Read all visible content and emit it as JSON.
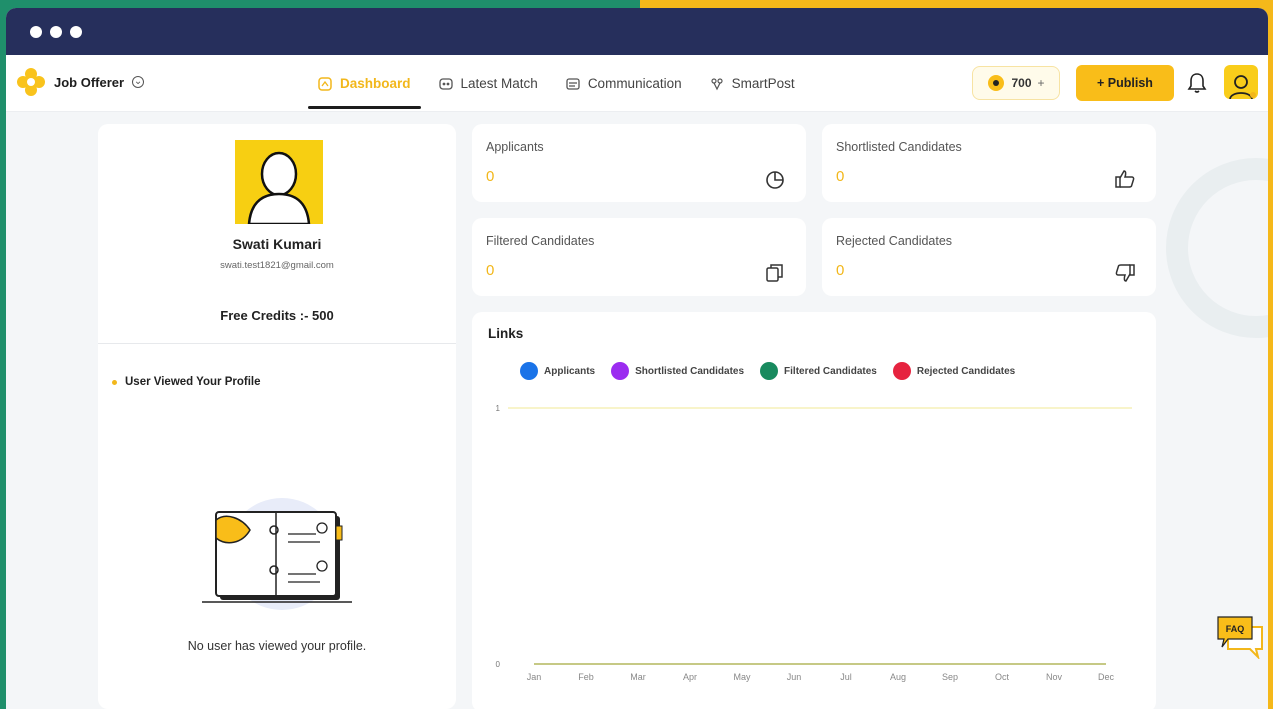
{
  "window_controls": [
    "close",
    "minimize",
    "maximize"
  ],
  "brand": {
    "name": "Job Offerer",
    "logo_icon": "flower-logo-icon",
    "chevron_icon": "chevron-down-circle-icon"
  },
  "tabs": [
    {
      "label": "Dashboard",
      "icon": "dashboard-icon",
      "active": true
    },
    {
      "label": "Latest Match",
      "icon": "match-icon",
      "active": false
    },
    {
      "label": "Communication",
      "icon": "chat-icon",
      "active": false
    },
    {
      "label": "SmartPost",
      "icon": "smartpost-icon",
      "active": false
    }
  ],
  "header": {
    "credits_value": "700",
    "credits_plus": "+",
    "publish_label": "+ Publish"
  },
  "colors": {
    "accent": "#f9bd19",
    "titlebar": "#262f5c",
    "applicants": "#1a73e8",
    "shortlisted": "#9b2cf0",
    "filtered": "#188a5e",
    "rejected": "#e6233f"
  },
  "profile": {
    "name": "Swati Kumari",
    "email": "swati.test1821@gmail.com",
    "credits_text": "Free Credits :- 500",
    "viewed_title": "User Viewed Your Profile",
    "empty_text": "No user has viewed your profile."
  },
  "stats": [
    {
      "label": "Applicants",
      "value": "0",
      "icon": "pie-chart-icon"
    },
    {
      "label": "Shortlisted Candidates",
      "value": "0",
      "icon": "thumbs-up-icon"
    },
    {
      "label": "Filtered Candidates",
      "value": "0",
      "icon": "copy-icon"
    },
    {
      "label": "Rejected Candidates",
      "value": "0",
      "icon": "thumbs-down-icon"
    }
  ],
  "links": {
    "title": "Links",
    "legend": [
      {
        "name": "Applicants",
        "color": "#1a73e8"
      },
      {
        "name": "Shortlisted Candidates",
        "color": "#9b2cf0"
      },
      {
        "name": "Filtered Candidates",
        "color": "#188a5e"
      },
      {
        "name": "Rejected Candidates",
        "color": "#e6233f"
      }
    ]
  },
  "faq_label": "FAQ",
  "chart_data": {
    "type": "line",
    "categories": [
      "Jan",
      "Feb",
      "Mar",
      "Apr",
      "May",
      "Jun",
      "Jul",
      "Aug",
      "Sep",
      "Oct",
      "Nov",
      "Dec"
    ],
    "y_ticks": [
      "1",
      "0"
    ],
    "ylim": [
      0,
      1
    ],
    "grid": false,
    "series": [
      {
        "name": "Applicants",
        "values": [
          0,
          0,
          0,
          0,
          0,
          0,
          0,
          0,
          0,
          0,
          0,
          0
        ]
      },
      {
        "name": "Shortlisted Candidates",
        "values": [
          0,
          0,
          0,
          0,
          0,
          0,
          0,
          0,
          0,
          0,
          0,
          0
        ]
      },
      {
        "name": "Filtered Candidates",
        "values": [
          0,
          0,
          0,
          0,
          0,
          0,
          0,
          0,
          0,
          0,
          0,
          0
        ]
      },
      {
        "name": "Rejected Candidates",
        "values": [
          0,
          0,
          0,
          0,
          0,
          0,
          0,
          0,
          0,
          0,
          0,
          0
        ]
      }
    ]
  }
}
